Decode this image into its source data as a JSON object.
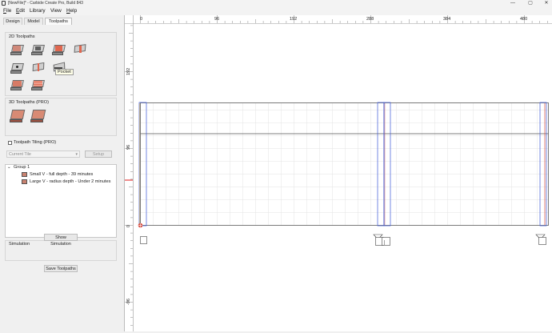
{
  "window": {
    "title": "[NewFile]* - Carbide Create Pro, Build 843",
    "controls": [
      "—",
      "▢",
      "✕"
    ]
  },
  "menu": [
    {
      "label": "File",
      "mnemonic": "F",
      "rest": "ile"
    },
    {
      "label": "Edit",
      "mnemonic": "E",
      "rest": "dit"
    },
    {
      "label": "Library",
      "mnemonic": "",
      "rest": "Library"
    },
    {
      "label": "View",
      "mnemonic": "",
      "rest": "View"
    },
    {
      "label": "Help",
      "mnemonic": "H",
      "rest": "elp"
    }
  ],
  "tabs": [
    {
      "label": "Design",
      "active": false
    },
    {
      "label": "Model",
      "active": false
    },
    {
      "label": "Toolpaths",
      "active": true
    }
  ],
  "toolpaths_2d": {
    "title": "2D Toolpaths",
    "tools": [
      "contour-icon",
      "pocket-icon",
      "pocket-icon",
      "vcarve-icon",
      "drill-icon",
      "groove-icon",
      "chamfer-icon",
      "texture-icon",
      "rough-icon"
    ],
    "tooltip": "Pocket"
  },
  "toolpaths_3d": {
    "title": "3D Toolpaths (PRO)",
    "tools": [
      "3d-rough-icon",
      "3d-finish-icon"
    ]
  },
  "tiling": {
    "label": "Toolpath Tiling (PRO)",
    "checked": false,
    "combo_value": "Current Tile",
    "setup_label": "Setup"
  },
  "tree": {
    "group_label": "Group 1",
    "items": [
      "Small V - full depth - 39 minutes",
      "Large V - radius depth - Under 2 minutes"
    ]
  },
  "simulation": {
    "title": "Simulation",
    "show_label": "Show Simulation",
    "save_label": "Save Toolpaths"
  },
  "rulers": {
    "top_labels": [
      "0",
      "96",
      "192",
      "288",
      "384",
      "480"
    ],
    "left_labels": [
      "192",
      "96",
      "0",
      "-96"
    ]
  },
  "colors": {
    "accent": "#e0674f",
    "stock_line": "#5a5a5a",
    "outline_blue": "#3d57d8",
    "outline_red": "#d84a3d"
  }
}
